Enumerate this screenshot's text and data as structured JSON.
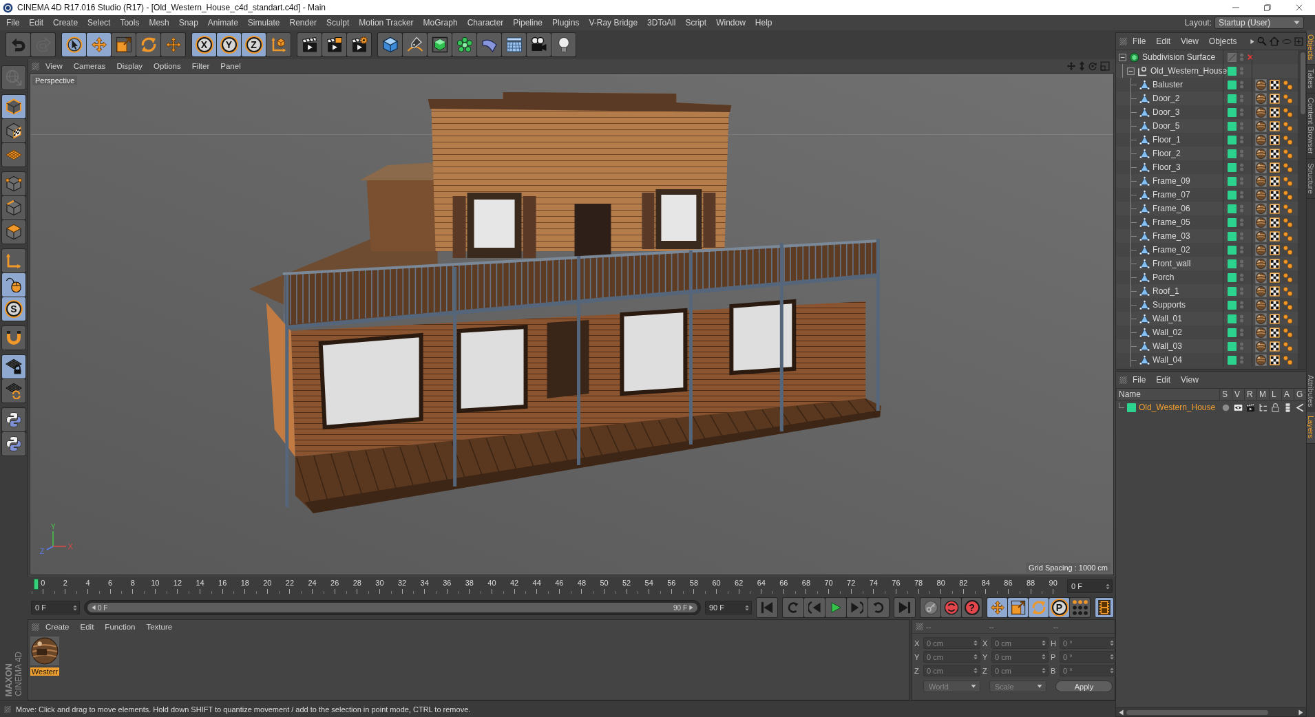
{
  "window": {
    "title": "CINEMA 4D R17.016 Studio (R17) - [Old_Western_House_c4d_standart.c4d] - Main"
  },
  "menu": [
    "File",
    "Edit",
    "Create",
    "Select",
    "Tools",
    "Mesh",
    "Snap",
    "Animate",
    "Simulate",
    "Render",
    "Sculpt",
    "Motion Tracker",
    "MoGraph",
    "Character",
    "Pipeline",
    "Plugins",
    "V-Ray Bridge",
    "3DToAll",
    "Script",
    "Window",
    "Help"
  ],
  "layout": {
    "label": "Layout:",
    "value": "Startup (User)"
  },
  "toolbar": [
    [
      {
        "kind": "undo",
        "active": false,
        "disabled": false
      },
      {
        "kind": "redo",
        "active": false,
        "disabled": true
      }
    ],
    [
      {
        "kind": "select",
        "active": true
      },
      {
        "kind": "move",
        "active": true
      },
      {
        "kind": "scale",
        "active": false
      },
      {
        "kind": "rotate",
        "active": false
      },
      {
        "kind": "transform",
        "active": false
      }
    ],
    [
      {
        "kind": "letter",
        "label": "X",
        "active": true
      },
      {
        "kind": "letter",
        "label": "Y",
        "active": true
      },
      {
        "kind": "letter",
        "label": "Z",
        "active": true
      },
      {
        "kind": "coords",
        "active": false
      }
    ],
    [
      {
        "kind": "render",
        "active": false
      },
      {
        "kind": "render-picture",
        "active": false
      },
      {
        "kind": "render-settings",
        "active": false
      }
    ],
    [
      {
        "kind": "cube",
        "active": false
      },
      {
        "kind": "pen",
        "active": false
      },
      {
        "kind": "subdivide",
        "active": false
      },
      {
        "kind": "cloner",
        "active": false
      },
      {
        "kind": "deformer",
        "active": false
      },
      {
        "kind": "floor",
        "active": false
      },
      {
        "kind": "camera",
        "active": false
      },
      {
        "kind": "light",
        "active": false
      }
    ]
  ],
  "left_toolbar": [
    [
      {
        "kind": "workplane",
        "active": false,
        "disabled": true
      }
    ],
    [
      {
        "kind": "model",
        "active": true
      },
      {
        "kind": "texture",
        "active": false
      },
      {
        "kind": "workplane-grid",
        "active": false
      }
    ],
    [
      {
        "kind": "points",
        "active": false
      },
      {
        "kind": "edges",
        "active": false
      },
      {
        "kind": "polygons",
        "active": false
      }
    ],
    [
      {
        "kind": "axis",
        "active": false
      },
      {
        "kind": "tweak",
        "active": true
      },
      {
        "kind": "letter",
        "label": "S",
        "active": true
      }
    ],
    [
      {
        "kind": "magnet",
        "active": false
      }
    ],
    [
      {
        "kind": "grid-lock",
        "active": true
      },
      {
        "kind": "grid-rotate",
        "active": false
      }
    ],
    [
      {
        "kind": "python",
        "active": false
      },
      {
        "kind": "python",
        "active": false
      }
    ]
  ],
  "brand": [
    "MAXON",
    "CINEMA 4D"
  ],
  "viewport": {
    "menu": [
      "View",
      "Cameras",
      "Display",
      "Options",
      "Filter",
      "Panel"
    ],
    "camera": "Perspective",
    "grid_spacing": "Grid Spacing : 1000 cm",
    "axis_labels": {
      "y": "Y",
      "z": "Z",
      "x": "X"
    }
  },
  "timeline": {
    "ticks": [
      "0",
      "2",
      "4",
      "6",
      "8",
      "10",
      "12",
      "14",
      "16",
      "18",
      "20",
      "22",
      "24",
      "26",
      "28",
      "30",
      "32",
      "34",
      "36",
      "38",
      "40",
      "42",
      "44",
      "46",
      "48",
      "50",
      "52",
      "54",
      "56",
      "58",
      "60",
      "62",
      "64",
      "66",
      "68",
      "70",
      "72",
      "74",
      "76",
      "78",
      "80",
      "82",
      "84",
      "86",
      "88",
      "90"
    ],
    "level": 0,
    "frame": "0 F"
  },
  "transport": {
    "start": "0 F",
    "range": {
      "start": "0 F",
      "end": "90 F",
      "level": 1
    },
    "end": "90 F",
    "playback": [
      [
        {
          "kind": "go-start"
        }
      ],
      [
        {
          "kind": "prev-key"
        },
        {
          "kind": "step-back"
        },
        {
          "kind": "play"
        },
        {
          "kind": "step-forward"
        },
        {
          "kind": "next-key"
        }
      ],
      [
        {
          "kind": "go-end"
        }
      ]
    ],
    "record": [
      {
        "kind": "autokey",
        "active": false
      },
      {
        "kind": "record",
        "active": false
      },
      {
        "kind": "help",
        "label": "?",
        "active": false
      }
    ],
    "keys": [
      {
        "kind": "move",
        "active": true
      },
      {
        "kind": "scale",
        "active": true
      },
      {
        "kind": "rotate",
        "active": true
      },
      {
        "kind": "letter",
        "label": "P",
        "active": true
      },
      {
        "kind": "dots",
        "active": false
      }
    ],
    "film": {
      "active": true
    }
  },
  "materials": {
    "menu": [
      "Create",
      "Edit",
      "Function",
      "Texture"
    ],
    "items": [
      {
        "name": "Westerr",
        "selected": true
      }
    ]
  },
  "coordinates": {
    "headers": [
      "--",
      "--",
      "--"
    ],
    "rows": [
      [
        {
          "axis": "X",
          "value": "0 cm"
        },
        {
          "axis": "X",
          "value": "0 cm"
        },
        {
          "axis": "H",
          "value": "0 °"
        }
      ],
      [
        {
          "axis": "Y",
          "value": "0 cm"
        },
        {
          "axis": "Y",
          "value": "0 cm"
        },
        {
          "axis": "P",
          "value": "0 °"
        }
      ],
      [
        {
          "axis": "Z",
          "value": "0 cm"
        },
        {
          "axis": "Z",
          "value": "0 cm"
        },
        {
          "axis": "B",
          "value": "0 °"
        }
      ]
    ],
    "dropdowns": [
      {
        "value": "World",
        "disabled": true
      },
      {
        "value": "Scale",
        "disabled": true
      }
    ],
    "apply": "Apply"
  },
  "status_bar": "Move: Click and drag to move elements. Hold down SHIFT to quantize movement / add to the selection in point mode, CTRL to remove.",
  "objects": {
    "menu": [
      "File",
      "Edit",
      "View",
      "Objects"
    ],
    "tree": [
      {
        "name": "Subdivision Surface",
        "kind": "generator",
        "enabled": false,
        "expanded": true,
        "children": [
          {
            "name": "Old_Western_House",
            "kind": "null",
            "color": "#2bd38e",
            "expanded": true,
            "children": [
              {
                "name": "Baluster",
                "kind": "polygon",
                "color": "#2bd38e"
              },
              {
                "name": "Door_2",
                "kind": "polygon",
                "color": "#2bd38e"
              },
              {
                "name": "Door_3",
                "kind": "polygon",
                "color": "#2bd38e"
              },
              {
                "name": "Door_5",
                "kind": "polygon",
                "color": "#2bd38e"
              },
              {
                "name": "Floor_1",
                "kind": "polygon",
                "color": "#2bd38e"
              },
              {
                "name": "Floor_2",
                "kind": "polygon",
                "color": "#2bd38e"
              },
              {
                "name": "Floor_3",
                "kind": "polygon",
                "color": "#2bd38e"
              },
              {
                "name": "Frame_09",
                "kind": "polygon",
                "color": "#2bd38e"
              },
              {
                "name": "Frame_07",
                "kind": "polygon",
                "color": "#2bd38e"
              },
              {
                "name": "Frame_06",
                "kind": "polygon",
                "color": "#2bd38e"
              },
              {
                "name": "Frame_05",
                "kind": "polygon",
                "color": "#2bd38e"
              },
              {
                "name": "Frame_03",
                "kind": "polygon",
                "color": "#2bd38e"
              },
              {
                "name": "Frame_02",
                "kind": "polygon",
                "color": "#2bd38e"
              },
              {
                "name": "Front_wall",
                "kind": "polygon",
                "color": "#2bd38e"
              },
              {
                "name": "Porch",
                "kind": "polygon",
                "color": "#2bd38e"
              },
              {
                "name": "Roof_1",
                "kind": "polygon",
                "color": "#2bd38e"
              },
              {
                "name": "Supports",
                "kind": "polygon",
                "color": "#2bd38e"
              },
              {
                "name": "Wall_01",
                "kind": "polygon",
                "color": "#2bd38e"
              },
              {
                "name": "Wall_02",
                "kind": "polygon",
                "color": "#2bd38e"
              },
              {
                "name": "Wall_03",
                "kind": "polygon",
                "color": "#2bd38e"
              },
              {
                "name": "Wall_04",
                "kind": "polygon",
                "color": "#2bd38e"
              }
            ]
          }
        ]
      }
    ]
  },
  "side_tabs_top": [
    {
      "label": "Objects",
      "selected": true
    },
    {
      "label": "Takes",
      "selected": false
    },
    {
      "label": "Content Browser",
      "selected": false
    },
    {
      "label": "Structure",
      "selected": false
    }
  ],
  "side_tabs_bottom": [
    {
      "label": "Attributes",
      "selected": false
    },
    {
      "label": "Layers",
      "selected": true
    }
  ],
  "layers": {
    "menu": [
      "File",
      "Edit",
      "View"
    ],
    "columns": [
      "Name",
      "S",
      "V",
      "R",
      "M",
      "L",
      "A",
      "G"
    ],
    "rows": [
      {
        "name": "Old_Western_House",
        "color": "#2bd38e",
        "selected": true
      }
    ]
  }
}
